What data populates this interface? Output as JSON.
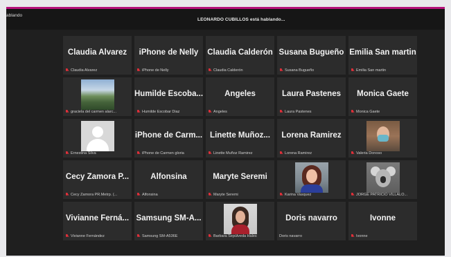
{
  "header": {
    "left_status": "ablando",
    "speaking": "LEONARDO CUBILLOS está hablando..."
  },
  "tiles": [
    {
      "name": "Claudia Alvarez",
      "label": "Claudia Alvarez"
    },
    {
      "name": "iPhone de Nelly",
      "label": "iPhone de Nelly"
    },
    {
      "name": "Claudia Calderón",
      "label": "Claudia Calderón"
    },
    {
      "name": "Susana Bugueño",
      "label": "Susana Bugueño"
    },
    {
      "name": "Emilia San martin",
      "label": "Emilia San martin"
    },
    {
      "name": "",
      "label": "graciela del carmen alarc..."
    },
    {
      "name": "Humilde Escoba...",
      "label": "Humilde Escobar Diaz"
    },
    {
      "name": "Angeles",
      "label": "Angeles"
    },
    {
      "name": "Laura Pastenes",
      "label": "Laura Pastenes"
    },
    {
      "name": "Monica Gaete",
      "label": "Monica Gaete"
    },
    {
      "name": "",
      "label": "Ernestina Silva"
    },
    {
      "name": "iPhone de Carm...",
      "label": "iPhone de Carmen gloria"
    },
    {
      "name": "Linette Muñoz...",
      "label": "Linette Muñoz Ramirez"
    },
    {
      "name": "Lorena Ramirez",
      "label": "Lorena Ramirez"
    },
    {
      "name": "",
      "label": "Valeria Donoso"
    },
    {
      "name": "Cecy Zamora P...",
      "label": "Cecy Zamora PR.Metrp. (..."
    },
    {
      "name": "Alfonsina",
      "label": "Alfonsina"
    },
    {
      "name": "Maryte Seremi",
      "label": "Maryte Seremi"
    },
    {
      "name": "",
      "label": "Karina Vasquez"
    },
    {
      "name": "",
      "label": "JORGE PATRICIO VILLALO..."
    },
    {
      "name": "Vivianne Ferná...",
      "label": "Vivianne Fernández"
    },
    {
      "name": "Samsung SM-A...",
      "label": "Samsung SM-A536E"
    },
    {
      "name": "",
      "label": "Barbara Sepúlveda Hales"
    },
    {
      "name": "Doris navarro",
      "label": "Doris navarro"
    },
    {
      "name": "Ivonne",
      "label": "Ivonne"
    }
  ]
}
